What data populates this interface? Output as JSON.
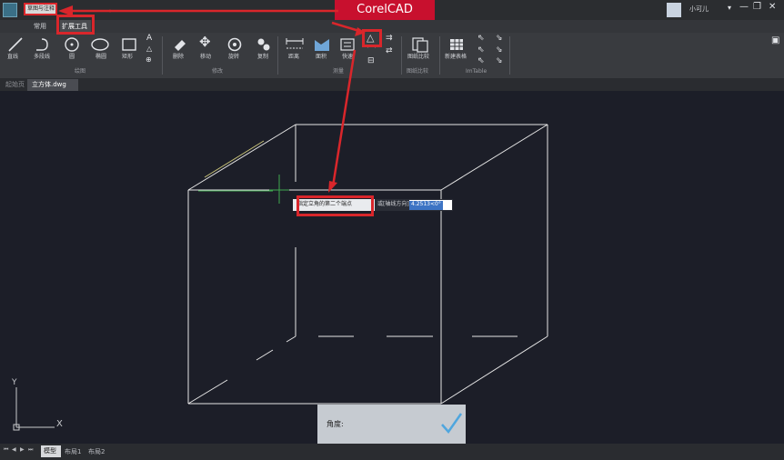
{
  "app": {
    "title_banner": "CorelCAD",
    "user_name": "小可儿",
    "quick_access_label": "草图与注释"
  },
  "menu_tabs": [
    "常用",
    "扩展工具"
  ],
  "ribbon": {
    "groups": [
      {
        "label": "绘图",
        "tools": [
          "直线",
          "多段线",
          "圆",
          "椭圆",
          "矩形"
        ]
      },
      {
        "label": "修改",
        "tools": [
          "删除",
          "移动",
          "旋转",
          "复制"
        ]
      },
      {
        "label": "测量",
        "tools": [
          "距离",
          "面积",
          "快速"
        ]
      },
      {
        "label": "图纸比较",
        "tools": [
          "图纸比较"
        ]
      },
      {
        "label": "ImTable",
        "tools": [
          "新建表格"
        ]
      }
    ]
  },
  "document_tabs": [
    "起始页",
    "立方体.dwg"
  ],
  "command_prompt": {
    "prompt_text": "指定立角的第二个端点",
    "option_text": "或[轴线方向]",
    "input_value": "4.2513<0°"
  },
  "angle_panel": {
    "label": "角度:"
  },
  "ucs": {
    "x_label": "X",
    "y_label": "Y"
  },
  "layout_tabs": [
    "模型",
    "布局1",
    "布局2"
  ],
  "colors": {
    "accent_red": "#d9262b",
    "canvas_bg": "#1c1e28",
    "ribbon_bg": "#393b3f",
    "prompt_highlight": "#3d74c4"
  }
}
